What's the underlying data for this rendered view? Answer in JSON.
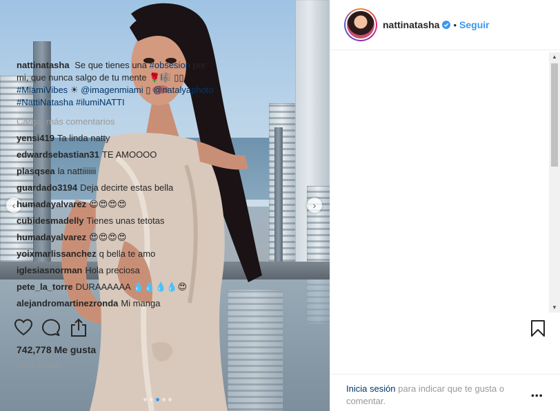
{
  "post": {
    "username": "nattinatasha",
    "follow_label": "Seguir",
    "separator": "•"
  },
  "caption": {
    "username": "nattinatasha",
    "text_1": "Se que tienes una",
    "tag_1": "#obsesion",
    "text_2": "por mi, que nunca salgo de tu mente 🌹🎼",
    "text_3": "▯▯",
    "tag_2": "#MiamiVibes",
    "text_4": "☀",
    "tag_3": "@imagenmiami",
    "text_5": "▯",
    "tag_4": "@natalyaphoto",
    "tag_5": "#NattiNatasha",
    "tag_6": "#ilumiNATTI"
  },
  "load_more_label": "Cargar más comentarios",
  "comments": [
    {
      "user": "yensi419",
      "text": "Ta linda natty"
    },
    {
      "user": "edwardsebastian31",
      "text": "TE AMOOOO"
    },
    {
      "user": "plasqsea",
      "text": "la nattiiiiiii"
    },
    {
      "user": "guardado3194",
      "text": "Deja decirte estas bella"
    },
    {
      "user": "humadayalvarez",
      "text": "😍😍😍😍"
    },
    {
      "user": "cubidesmadelly",
      "text": "Tienes unas tetotas"
    },
    {
      "user": "humadayalvarez",
      "text": "😍😍😍😍"
    },
    {
      "user": "yoixmarlissanchez",
      "text": "q bella te amo"
    },
    {
      "user": "iglesiasnorman",
      "text": "Hola preciosa"
    },
    {
      "user": "pete_la_torre",
      "text": "DURAAAAAA 💧💧💧💧😍"
    },
    {
      "user": "alejandromartinezronda",
      "text": "Mi manga"
    }
  ],
  "likes_label": "742,778 Me gusta",
  "date_label": "HACE 2 DÍAS",
  "footer": {
    "login_link": "Inicia sesión",
    "login_text": "para indicar que te gusta o comentar.",
    "more_label": "•••"
  },
  "carousel": {
    "slide_count": 5,
    "active_index": 2
  },
  "icons": [
    "heart-icon",
    "comment-icon",
    "share-icon",
    "bookmark-icon",
    "verified-badge-icon",
    "chevron-left-icon",
    "chevron-right-icon"
  ],
  "colors": {
    "link": "#3897f0",
    "hashtag": "#003569",
    "muted": "#999999",
    "text": "#262626"
  }
}
